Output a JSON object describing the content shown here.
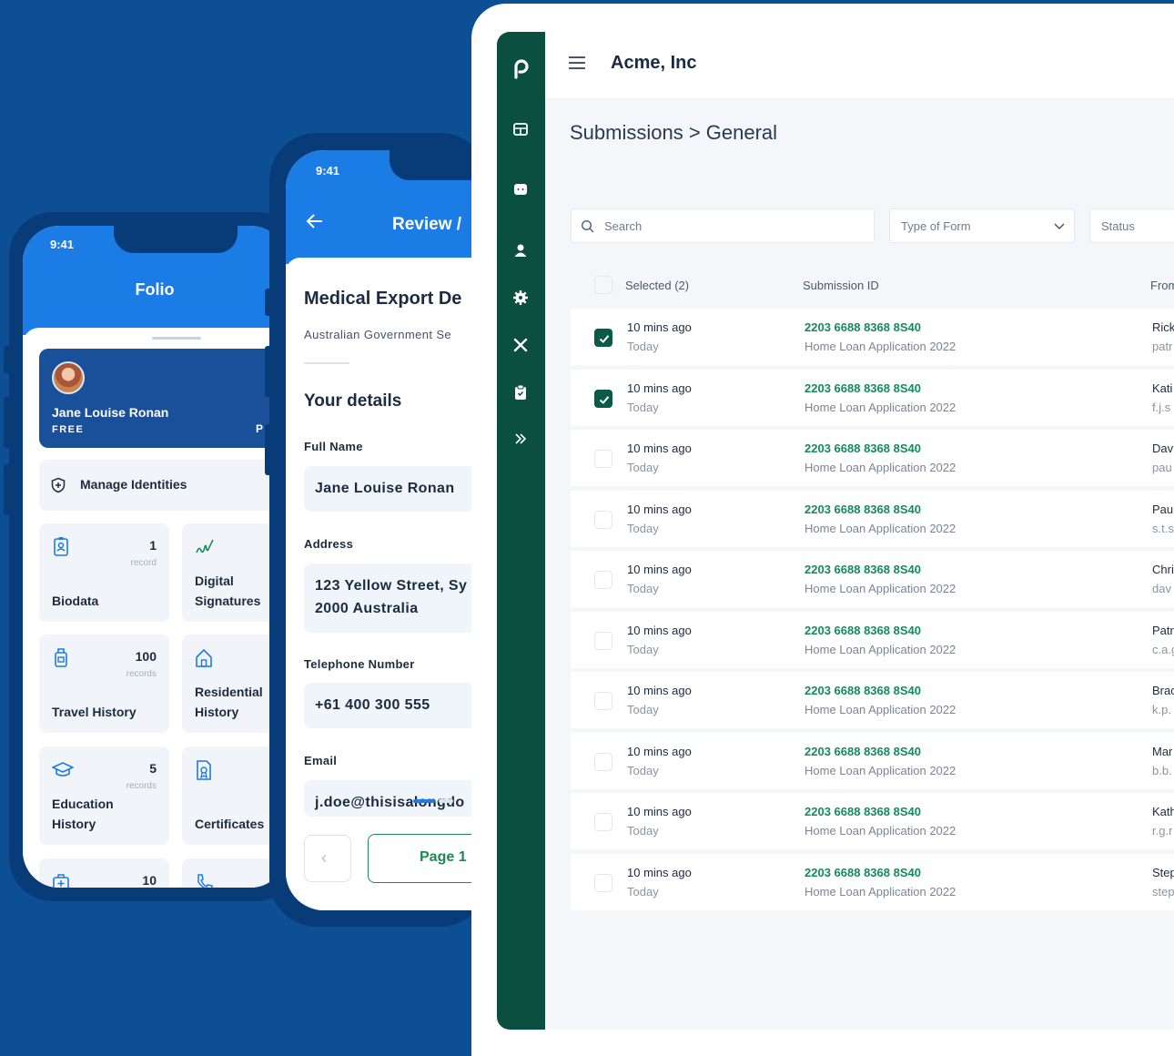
{
  "phone_folio": {
    "status_time": "9:41",
    "title": "Folio",
    "profile": {
      "name": "Jane Louise Ronan",
      "plan": "FREE",
      "plan_right": "P"
    },
    "manage_identities": "Manage Identities",
    "tiles": [
      {
        "label": "Biodata",
        "count": "1",
        "unit": "record",
        "icon": "id-badge-icon"
      },
      {
        "label": "Digital\nSignatures",
        "count": "",
        "unit": "r",
        "icon": "signature-icon"
      },
      {
        "label": "Travel History",
        "count": "100",
        "unit": "records",
        "icon": "luggage-icon"
      },
      {
        "label": "Residential\nHistory",
        "count": "",
        "unit": "r",
        "icon": "home-icon"
      },
      {
        "label": "Education\nHistory",
        "count": "5",
        "unit": "records",
        "icon": "graduation-cap-icon"
      },
      {
        "label": "Certificates",
        "count": "",
        "unit": "",
        "icon": "certificate-icon"
      },
      {
        "label": "",
        "count": "10",
        "unit": "",
        "icon": "medical-kit-icon"
      },
      {
        "label": "",
        "count": "",
        "unit": "",
        "icon": "phone-call-icon"
      }
    ]
  },
  "phone_review": {
    "status_time": "9:41",
    "title": "Review /",
    "heading": "Medical Export De",
    "subtitle": "Australian Government Se",
    "section": "Your details",
    "fields": [
      {
        "label": "Full Name",
        "value": "Jane Louise Ronan"
      },
      {
        "label": "Address",
        "value": "123 Yellow Street, Sy\n2000 Australia"
      },
      {
        "label": "Telephone Number",
        "value": "+61 400 300 555"
      },
      {
        "label": "Email",
        "value": "j.doe@thisisalongdo"
      }
    ],
    "page_button": "Page 1"
  },
  "desktop": {
    "company": "Acme, Inc",
    "breadcrumb": "Submissions > General",
    "search_placeholder": "Search",
    "type_of_form": "Type of Form",
    "status": "Status",
    "columns": {
      "selected": "Selected (2)",
      "submission_id": "Submission ID",
      "from": "From"
    },
    "accent": "#0b4f41",
    "rows": [
      {
        "checked": true,
        "time": "10 mins ago",
        "day": "Today",
        "id": "2203 6688 8368 8S40",
        "form": "Home Loan Application 2022",
        "from": "Rick",
        "email": "patr"
      },
      {
        "checked": true,
        "time": "10 mins ago",
        "day": "Today",
        "id": "2203 6688 8368 8S40",
        "form": "Home Loan Application 2022",
        "from": "Kati",
        "email": "f.j.s"
      },
      {
        "checked": false,
        "time": "10 mins ago",
        "day": "Today",
        "id": "2203 6688 8368 8S40",
        "form": "Home Loan Application 2022",
        "from": "Dav",
        "email": "pau"
      },
      {
        "checked": false,
        "time": "10 mins ago",
        "day": "Today",
        "id": "2203 6688 8368 8S40",
        "form": "Home Loan Application 2022",
        "from": "Pau",
        "email": "s.t.s"
      },
      {
        "checked": false,
        "time": "10 mins ago",
        "day": "Today",
        "id": "2203 6688 8368 8S40",
        "form": "Home Loan Application 2022",
        "from": "Chri",
        "email": "dav"
      },
      {
        "checked": false,
        "time": "10 mins ago",
        "day": "Today",
        "id": "2203 6688 8368 8S40",
        "form": "Home Loan Application 2022",
        "from": "Patr",
        "email": "c.a.g"
      },
      {
        "checked": false,
        "time": "10 mins ago",
        "day": "Today",
        "id": "2203 6688 8368 8S40",
        "form": "Home Loan Application 2022",
        "from": "Brac",
        "email": "k.p."
      },
      {
        "checked": false,
        "time": "10 mins ago",
        "day": "Today",
        "id": "2203 6688 8368 8S40",
        "form": "Home Loan Application 2022",
        "from": "Mar",
        "email": "b.b."
      },
      {
        "checked": false,
        "time": "10 mins ago",
        "day": "Today",
        "id": "2203 6688 8368 8S40",
        "form": "Home Loan Application 2022",
        "from": "Kath",
        "email": "r.g.r"
      },
      {
        "checked": false,
        "time": "10 mins ago",
        "day": "Today",
        "id": "2203 6688 8368 8S40",
        "form": "Home Loan Application 2022",
        "from": "Step",
        "email": "step"
      }
    ]
  }
}
